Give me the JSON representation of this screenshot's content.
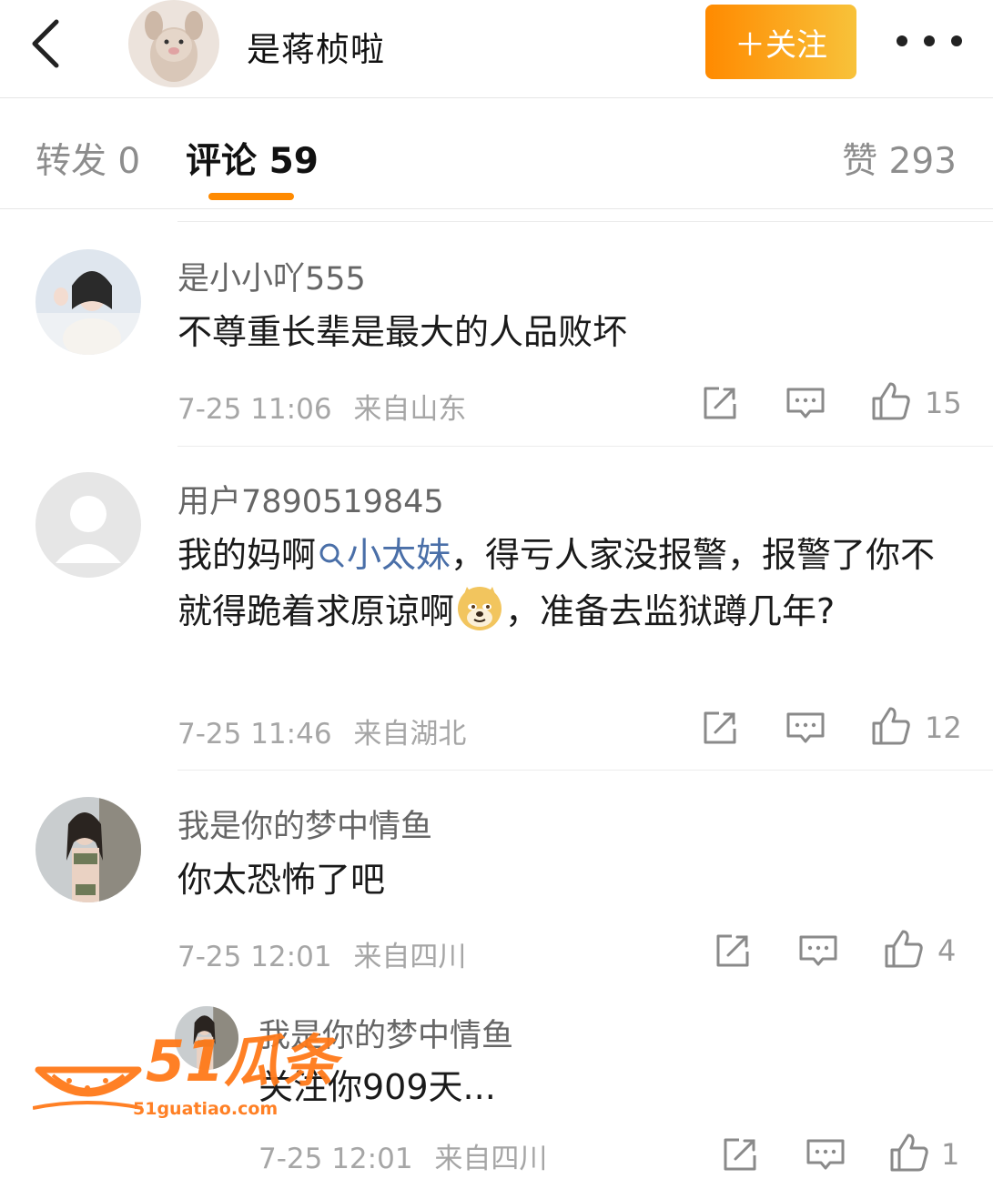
{
  "colors": {
    "accent_orange": "#ff8a00",
    "follow_gradient_start": "#ff8a00",
    "follow_gradient_end": "#f8c23a",
    "link_blue": "#4a6fa8",
    "watermark_orange": "#ff7a1a"
  },
  "header": {
    "back_icon": "chevron-left-icon",
    "user_name": "是蒋桢啦",
    "follow_label": "＋关注",
    "more_icon": "more-dots-icon"
  },
  "tabs": {
    "repost": "转发 0",
    "comments": "评论 59",
    "likes": "赞 293"
  },
  "comments": [
    {
      "name": "是小小吖555",
      "text": "不尊重长辈是最大的人品败坏",
      "time": "7-25 11:06",
      "location": "来自山东",
      "likes": "15"
    },
    {
      "name": "用户7890519845",
      "text_prefix": "我的妈啊",
      "topic": "小太妹",
      "text_mid": "，得亏人家没报警，报警了你不就得跪着求原谅啊",
      "emoji": "doge-emoji",
      "text_suffix": "，准备去监狱蹲几年?",
      "time": "7-25 11:46",
      "location": "来自湖北",
      "likes": "12"
    },
    {
      "name": "我是你的梦中情鱼",
      "text": "你太恐怖了吧",
      "time": "7-25 12:01",
      "location": "来自四川",
      "likes": "4"
    }
  ],
  "reply": {
    "name": "我是你的梦中情鱼",
    "text": "关注你909天...",
    "time": "7-25 12:01",
    "location": "来自四川",
    "likes": "1"
  },
  "watermark": {
    "logo_text": "51瓜条",
    "url": "51guatiao.com"
  },
  "icons": {
    "repost": "share-square-icon",
    "comment": "comment-bubble-icon",
    "like": "thumbs-up-icon"
  }
}
